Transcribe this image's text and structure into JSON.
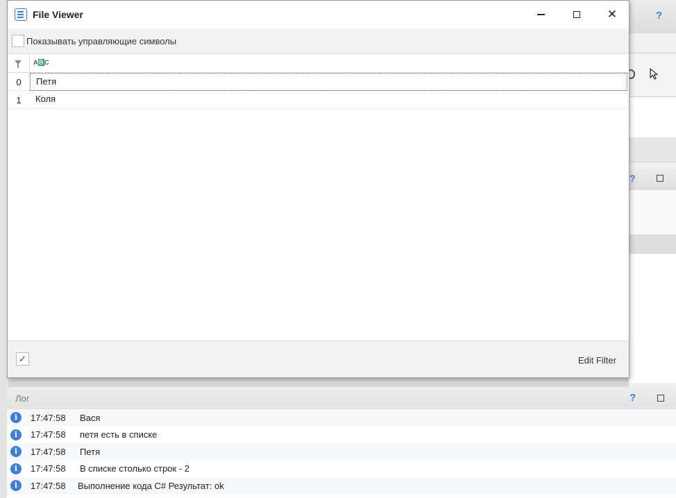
{
  "dialog": {
    "title": "File Viewer",
    "show_control_chars_label": "Показывать управляющие символы",
    "rows": [
      {
        "index": "0",
        "value": "Петя"
      },
      {
        "index": "1",
        "value": "Коля"
      }
    ],
    "footer_check_glyph": "✓",
    "edit_filter_label": "Edit Filter",
    "close_glyph": "✕"
  },
  "background": {
    "help_glyph": "?"
  },
  "log": {
    "title": "Лог",
    "help_glyph": "?",
    "entries": [
      {
        "time": "17:47:58",
        "message": "Вася"
      },
      {
        "time": "17:47:58",
        "message": "петя есть в списке"
      },
      {
        "time": "17:47:58",
        "message": "Петя"
      },
      {
        "time": "17:47:58",
        "message": "В списке столько строк - 2"
      },
      {
        "time": "17:47:58",
        "message": "Выполнение кода C#  Результат: ok"
      }
    ]
  },
  "colors": {
    "accent": "#3b7dd8",
    "info_icon": "#3d7fd9",
    "abc_icon_green": "#2aa76b"
  }
}
